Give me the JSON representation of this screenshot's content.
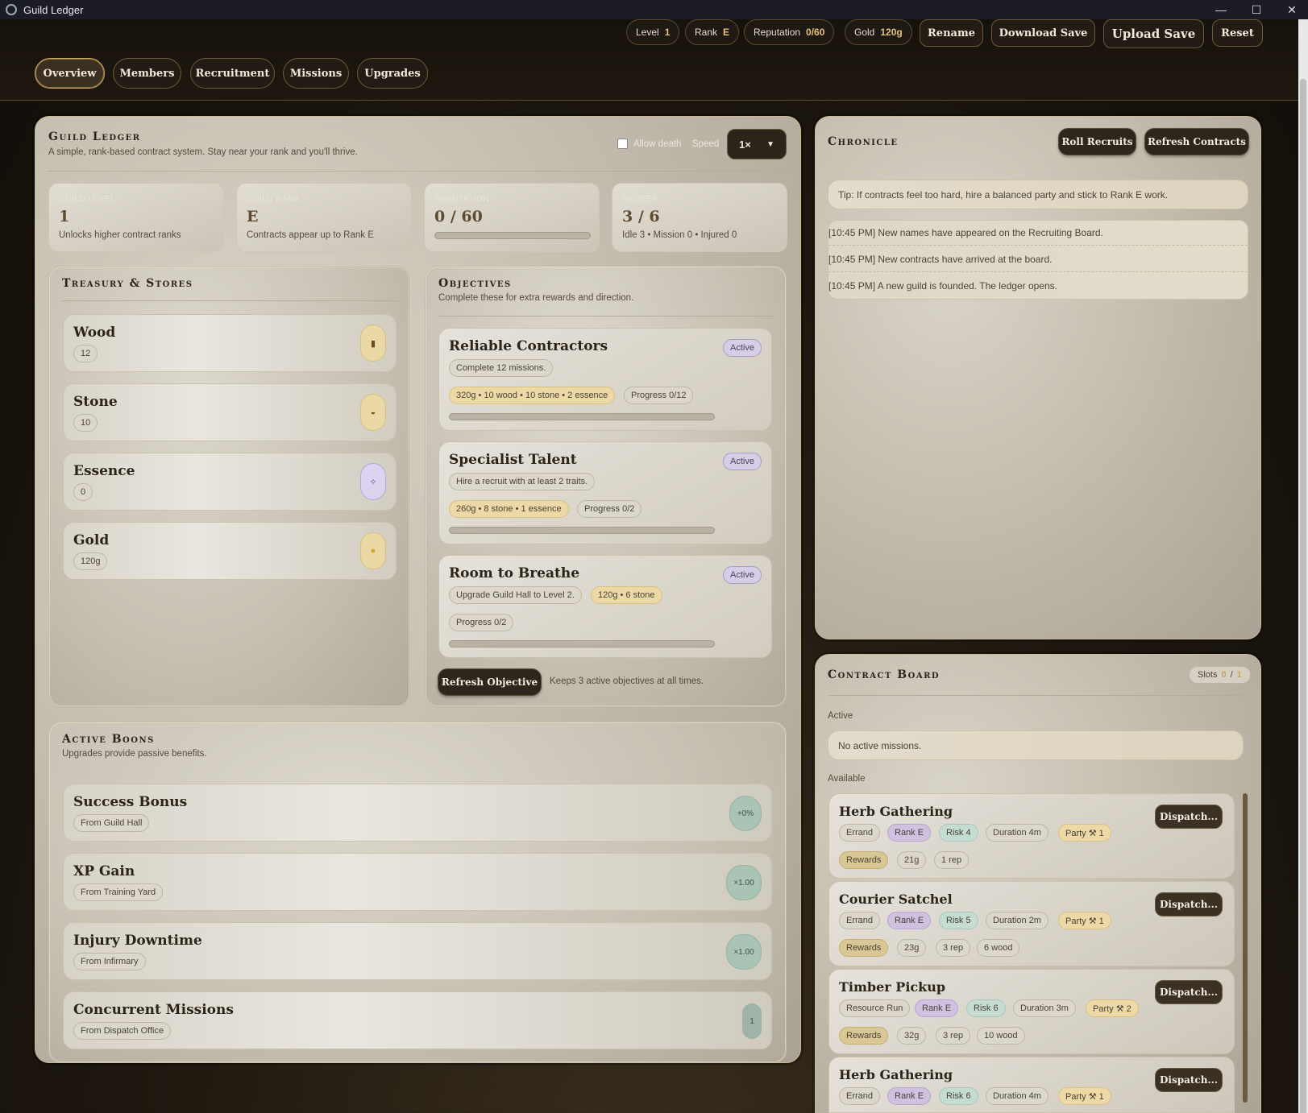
{
  "window": {
    "title": "Guild Ledger",
    "minimize": "—",
    "maximize": "☐",
    "close": "✕"
  },
  "topbar": {
    "level_label": "Level",
    "level_value": "1",
    "rank_label": "Rank",
    "rank_value": "E",
    "rep_label": "Reputation",
    "rep_value": "0/60",
    "gold_label": "Gold",
    "gold_value": "120g",
    "rename": "Rename",
    "download": "Download Save",
    "upload": "Upload Save",
    "reset": "Reset"
  },
  "tabs": [
    "Overview",
    "Members",
    "Recruitment",
    "Missions",
    "Upgrades"
  ],
  "ledger": {
    "title": "Guild Ledger",
    "subtitle": "A simple, rank-based contract system. Stay near your rank and you'll thrive.",
    "allow_death": "Allow death",
    "speed_label": "Speed",
    "speed_value": "1×",
    "stats": [
      {
        "label": "GUILD LEVEL",
        "value": "1",
        "sub": "Unlocks higher contract ranks"
      },
      {
        "label": "GUILD RANK",
        "value": "E",
        "sub": "Contracts appear up to Rank E"
      },
      {
        "label": "REPUTATION",
        "value": "0 / 60",
        "progress": 0
      },
      {
        "label": "ROSTER",
        "value": "3 / 6",
        "sub": "Idle 3 • Mission 0 • Injured 0"
      }
    ]
  },
  "treasury": {
    "title": "Treasury & Stores",
    "items": [
      {
        "name": "Wood",
        "amount": "12",
        "icon": "log-icon",
        "glyph": "▮"
      },
      {
        "name": "Stone",
        "amount": "10",
        "icon": "stone-icon",
        "glyph": "◒"
      },
      {
        "name": "Essence",
        "amount": "0",
        "icon": "essence-icon",
        "glyph": "✧"
      },
      {
        "name": "Gold",
        "amount": "120g",
        "icon": "gold-coin-icon",
        "glyph": "●"
      }
    ]
  },
  "objectives": {
    "title": "Objectives",
    "subtitle": "Complete these for extra rewards and direction.",
    "items": [
      {
        "name": "Reliable Contractors",
        "status": "Active",
        "desc": "Complete 12 missions.",
        "reward": "320g • 10 wood • 10 stone • 2 essence",
        "progress": "Progress 0/12"
      },
      {
        "name": "Specialist Talent",
        "status": "Active",
        "desc": "Hire a recruit with at least 2 traits.",
        "reward": "260g • 8 stone • 1 essence",
        "progress": "Progress 0/2"
      },
      {
        "name": "Room to Breathe",
        "status": "Active",
        "desc": "Upgrade Guild Hall to Level 2.",
        "reward": "120g • 6 stone",
        "progress": "Progress 0/2"
      }
    ],
    "refresh": "Refresh Objective",
    "refresh_note": "Keeps 3 active objectives at all times."
  },
  "boons": {
    "title": "Active Boons",
    "subtitle": "Upgrades provide passive benefits.",
    "items": [
      {
        "name": "Success Bonus",
        "source": "From Guild Hall",
        "value": "+0%"
      },
      {
        "name": "XP Gain",
        "source": "From Training Yard",
        "value": "×1.00"
      },
      {
        "name": "Injury Downtime",
        "source": "From Infirmary",
        "value": "×1.00"
      },
      {
        "name": "Concurrent Missions",
        "source": "From Dispatch Office",
        "value": "1"
      }
    ]
  },
  "chronicle": {
    "title": "Chronicle",
    "roll": "Roll Recruits",
    "refresh": "Refresh Contracts",
    "tip": "Tip: If contracts feel too hard, hire a balanced party and stick to Rank E work.",
    "log": [
      "[10:45 PM] New names have appeared on the Recruiting Board.",
      "[10:45 PM] New contracts have arrived at the board.",
      "[10:45 PM] A new guild is founded. The ledger opens."
    ]
  },
  "contracts": {
    "title": "Contract Board",
    "slots_label": "Slots",
    "slots_used": "0",
    "slots_sep": "/",
    "slots_total": "1",
    "active_label": "Active",
    "no_active": "No active missions.",
    "available_label": "Available",
    "dispatch": "Dispatch...",
    "rewards_label": "Rewards",
    "items": [
      {
        "name": "Herb Gathering",
        "type": "Errand",
        "rank": "Rank E",
        "risk": "Risk 4",
        "duration": "Duration 4m",
        "party": "Party ⚒ 1",
        "rewards": [
          "21g",
          "1 rep"
        ]
      },
      {
        "name": "Courier Satchel",
        "type": "Errand",
        "rank": "Rank E",
        "risk": "Risk 5",
        "duration": "Duration 2m",
        "party": "Party ⚒ 1",
        "rewards": [
          "23g",
          "3 rep",
          "6 wood"
        ]
      },
      {
        "name": "Timber Pickup",
        "type": "Resource Run",
        "rank": "Rank E",
        "risk": "Risk 6",
        "duration": "Duration 3m",
        "party": "Party ⚒ 2",
        "rewards": [
          "32g",
          "3 rep",
          "10 wood"
        ]
      },
      {
        "name": "Herb Gathering",
        "type": "Errand",
        "rank": "Rank E",
        "risk": "Risk 6",
        "duration": "Duration 4m",
        "party": "Party ⚒ 1",
        "rewards": []
      }
    ]
  }
}
